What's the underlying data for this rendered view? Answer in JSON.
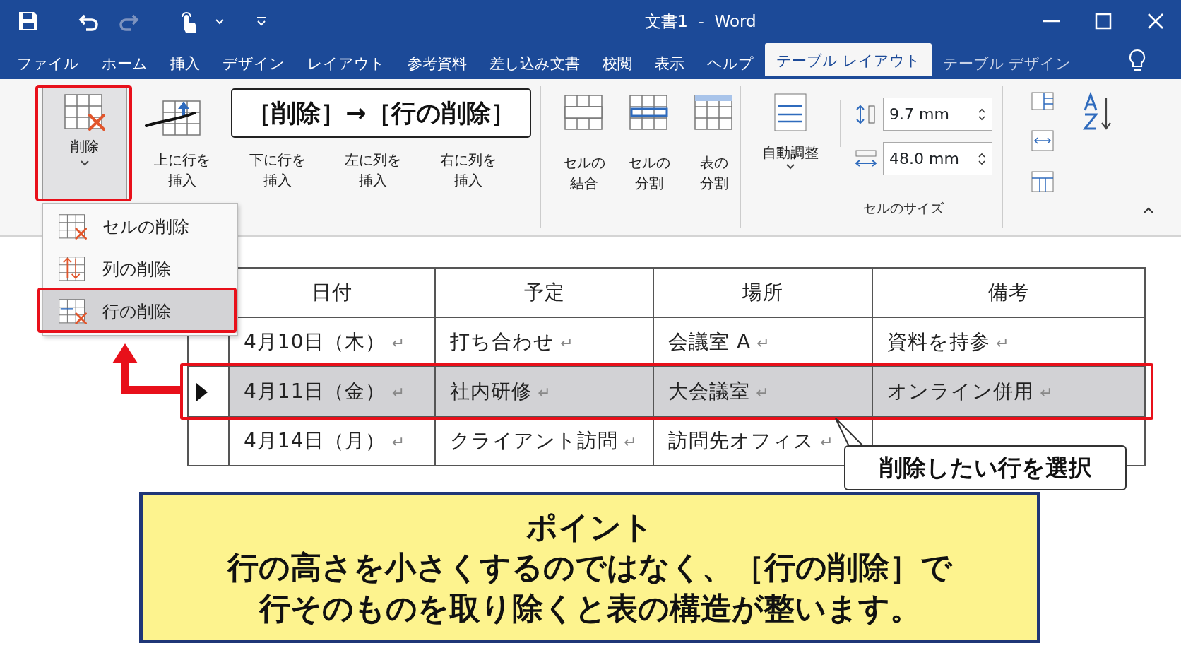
{
  "title_bar": {
    "title": "文書1  -  Word"
  },
  "ribbon_tabs": [
    {
      "label": "ファイル",
      "selected": false
    },
    {
      "label": "ホーム",
      "selected": false
    },
    {
      "label": "挿入",
      "selected": false
    },
    {
      "label": "デザイン",
      "selected": false
    },
    {
      "label": "レイアウト",
      "selected": false
    },
    {
      "label": "参考資料",
      "selected": false
    },
    {
      "label": "差し込み文書",
      "selected": false
    },
    {
      "label": "校閲",
      "selected": false
    },
    {
      "label": "表示",
      "selected": false
    },
    {
      "label": "ヘルプ",
      "selected": false
    },
    {
      "label": "テーブル レイアウト",
      "selected": true
    },
    {
      "label": "テーブル デザイン",
      "selected": false
    }
  ],
  "ribbon": {
    "delete_button": {
      "label": "削除"
    },
    "insert_buttons": [
      [
        "上に行を",
        "挿入"
      ],
      [
        "下に行を",
        "挿入"
      ],
      [
        "左に列を",
        "挿入"
      ],
      [
        "右に列を",
        "挿入"
      ]
    ],
    "merge_buttons": [
      {
        "label": [
          "セルの",
          "結合"
        ],
        "kind": "merge"
      },
      {
        "label": [
          "セルの",
          "分割"
        ],
        "kind": "split"
      },
      {
        "label": [
          "表の",
          "分割"
        ],
        "kind": "table"
      }
    ],
    "autofit_button": {
      "label": "自動調整"
    },
    "cell_size": {
      "height": "9.7 mm",
      "width": "48.0 mm",
      "group_label": "セルのサイズ"
    }
  },
  "delete_menu": [
    {
      "label": "セルの削除",
      "kind": "cell",
      "selected": false
    },
    {
      "label": "列の削除",
      "kind": "column",
      "selected": false
    },
    {
      "label": "行の削除",
      "kind": "row",
      "selected": true
    }
  ],
  "instruction": "［削除］→［行の削除］",
  "table": {
    "columns": [
      "日付",
      "予定",
      "場所",
      "備考"
    ],
    "rows": [
      {
        "selected": false,
        "cells": [
          {
            "text": "4月10日（木）",
            "mark": "↵"
          },
          {
            "text": "打ち合わせ",
            "mark": "↵"
          },
          {
            "text": "会議室 A",
            "mark": "↵"
          },
          {
            "text": "資料を持参",
            "mark": "↵"
          }
        ]
      },
      {
        "selected": true,
        "cells": [
          {
            "text": "4月11日（金）",
            "mark": "↵"
          },
          {
            "text": "社内研修",
            "mark": "↵"
          },
          {
            "text": "大会議室",
            "mark": "↵"
          },
          {
            "text": "オンライン併用",
            "mark": "↵"
          }
        ]
      },
      {
        "selected": false,
        "cells": [
          {
            "text": "4月14日（月）",
            "mark": "↵"
          },
          {
            "text": "クライアント訪問",
            "mark": "↵"
          },
          {
            "text": "訪問先オフィス",
            "mark": "↵"
          }
        ]
      }
    ]
  },
  "callout": "削除したい行を選択",
  "point_box": {
    "title": "ポイント",
    "lines": [
      "行の高さを小さくするのではなく、［行の削除］で",
      "行そのものを取り除くと表の構造が整います。"
    ]
  }
}
